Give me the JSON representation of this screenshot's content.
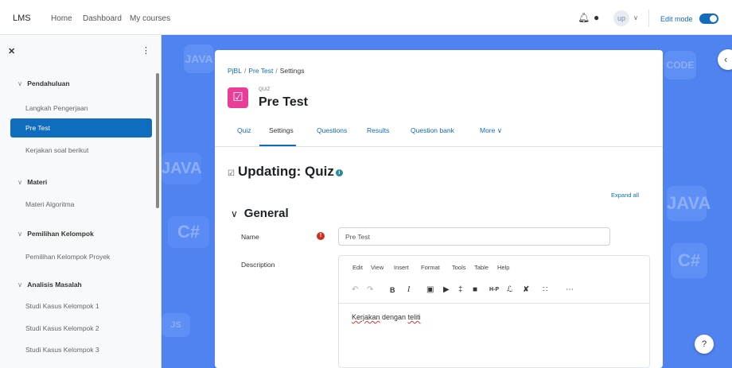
{
  "navbar": {
    "brand": "LMS",
    "links": [
      "Home",
      "Dashboard",
      "My courses"
    ],
    "avatar_initials": "up",
    "edit_mode_label": "Edit mode",
    "edit_mode_on": true
  },
  "sidebar": {
    "sections": [
      {
        "title": "Pendahuluan",
        "items": [
          "Langkah Pengerjaan",
          "Pre Test",
          "Kerjakan soal berikut"
        ]
      },
      {
        "title": "Materi",
        "items": [
          "Materi Algoritma"
        ]
      },
      {
        "title": "Pemilihan Kelompok",
        "items": [
          "Pemilihan Kelompok Proyek"
        ]
      },
      {
        "title": "Analisis Masalah",
        "items": [
          "Studi Kasus Kelompok 1",
          "Studi Kasus Kelompok 2",
          "Studi Kasus Kelompok 3"
        ]
      }
    ],
    "active_item": "Pre Test"
  },
  "breadcrumb": [
    "PjBL",
    "Pre Test",
    "Settings"
  ],
  "module": {
    "type": "QUIZ",
    "title": "Pre Test"
  },
  "tabs": [
    "Quiz",
    "Settings",
    "Questions",
    "Results",
    "Question bank",
    "More"
  ],
  "active_tab": "Settings",
  "page_heading": "Updating: Quiz",
  "expand_all": "Expand all",
  "section_general": "General",
  "form": {
    "name_label": "Name",
    "name_value": "Pre Test",
    "description_label": "Description"
  },
  "editor": {
    "menus": [
      "Edit",
      "View",
      "Insert",
      "Format",
      "Tools",
      "Table",
      "Help"
    ],
    "text_word1": "Kerjakan",
    "text_mid": " dengan ",
    "text_word2": "teliti"
  },
  "background_tiles": [
    "JAVA",
    "C#",
    "JAVA",
    "C#",
    "JAVA",
    "CODE",
    "JS",
    "CODE"
  ],
  "colors": {
    "accent": "#0f6cbf",
    "quiz_icon": "#ea3d98",
    "background": "#4f83f0",
    "required": "#ca3120"
  }
}
